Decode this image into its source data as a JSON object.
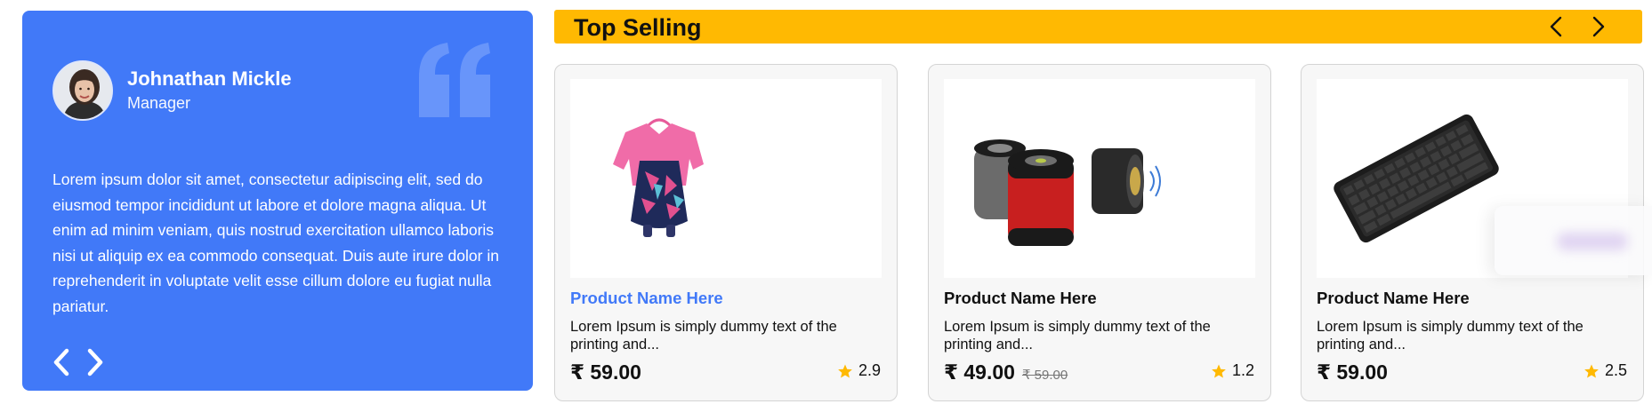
{
  "testimonial": {
    "name": "Johnathan Mickle",
    "role": "Manager",
    "body": "Lorem ipsum dolor sit amet, consectetur adipiscing elit, sed do eiusmod tempor incididunt ut labore et dolore magna aliqua. Ut enim ad minim veniam, quis nostrud exercitation ullamco laboris nisi ut aliquip ex ea commodo consequat. Duis aute irure dolor in reprehenderit in voluptate velit esse cillum dolore eu fugiat nulla pariatur.",
    "prev_icon": "chevron-left-icon",
    "next_icon": "chevron-right-icon",
    "quote_icon": "quote-icon"
  },
  "top_selling": {
    "title": "Top Selling",
    "prev_icon": "chevron-left-icon",
    "next_icon": "chevron-right-icon"
  },
  "products": [
    {
      "name": "Product Name Here",
      "description": "Lorem Ipsum is simply dummy text of the printing and...",
      "price": "₹ 59.00",
      "old_price": "",
      "rating": "2.9",
      "image": "dress-image"
    },
    {
      "name": "Product Name Here",
      "description": "Lorem Ipsum is simply dummy text of the printing and...",
      "price": "₹ 49.00",
      "old_price": "₹ 59.00",
      "rating": "1.2",
      "image": "speakers-image"
    },
    {
      "name": "Product Name Here",
      "description": "Lorem Ipsum is simply dummy text of the printing and...",
      "price": "₹ 59.00",
      "old_price": "",
      "rating": "2.5",
      "image": "keyboard-image"
    }
  ],
  "colors": {
    "accent_blue": "#4179f8",
    "accent_yellow": "#ffb902",
    "star": "#ffb902"
  }
}
